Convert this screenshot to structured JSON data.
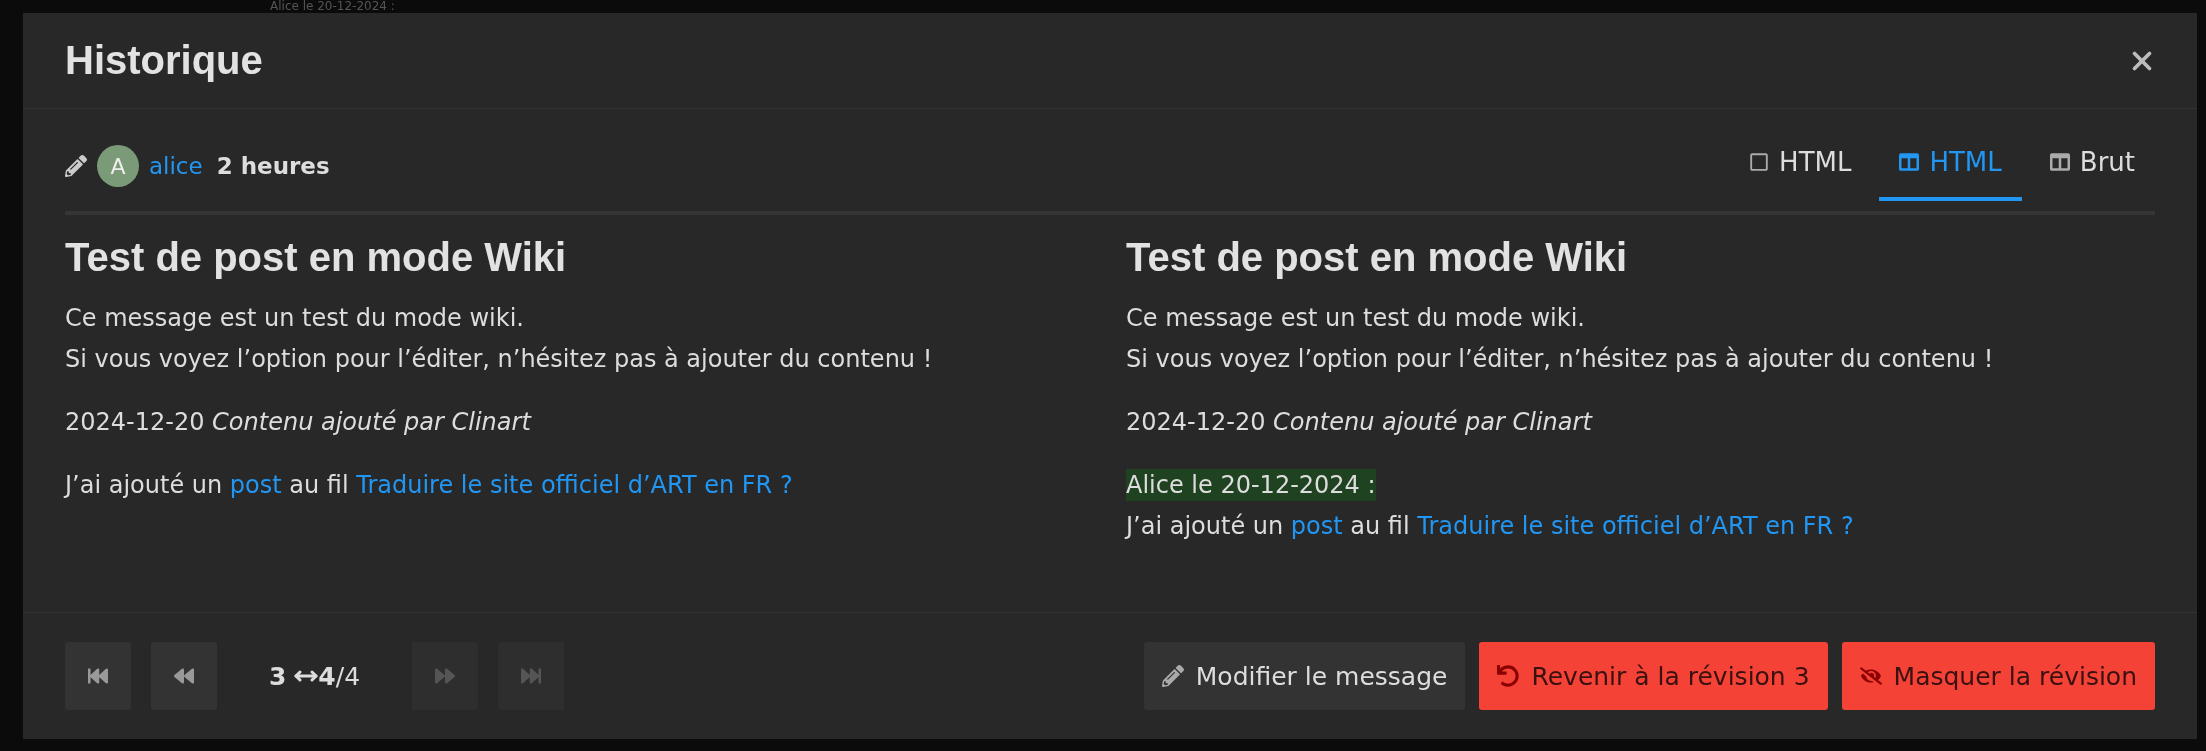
{
  "backdrop_text": "Alice le 20-12-2024 :",
  "modal": {
    "title": "Historique",
    "revision": {
      "author_initial": "A",
      "author": "alice",
      "age": "2 heures"
    },
    "view_tabs": [
      {
        "label": "HTML",
        "kind": "inline",
        "selected": false
      },
      {
        "label": "HTML",
        "kind": "side_by_side",
        "selected": true
      },
      {
        "label": "Brut",
        "kind": "side_by_side",
        "selected": false
      }
    ],
    "columns": [
      {
        "heading": "Test de post en mode Wiki",
        "paragraphs": [
          [
            [
              {
                "kind": "text",
                "text": "Ce message est un test du mode wiki."
              }
            ],
            [
              {
                "kind": "text",
                "text": "Si vous voyez l’option pour l’éditer, n’hésitez pas à ajouter du contenu !"
              }
            ]
          ],
          [
            [
              {
                "kind": "text",
                "text": "2024-12-20 *Contenu ajouté par Clinart*"
              }
            ]
          ],
          [
            [
              {
                "kind": "text",
                "text": "J’ai ajouté un "
              },
              {
                "kind": "link",
                "text": "post"
              },
              {
                "kind": "text",
                "text": " au fil "
              },
              {
                "kind": "link",
                "text": "Traduire le site officiel d’ART en FR ?"
              }
            ]
          ]
        ]
      },
      {
        "heading": "Test de post en mode Wiki",
        "paragraphs": [
          [
            [
              {
                "kind": "text",
                "text": "Ce message est un test du mode wiki."
              }
            ],
            [
              {
                "kind": "text",
                "text": "Si vous voyez l’option pour l’éditer, n’hésitez pas à ajouter du contenu !"
              }
            ]
          ],
          [
            [
              {
                "kind": "text",
                "text": "2024-12-20 *Contenu ajouté par Clinart*"
              }
            ]
          ],
          [
            [
              {
                "kind": "inserted",
                "text": "Alice le 20-12-2024 :"
              }
            ],
            [
              {
                "kind": "text",
                "text": "J’ai ajouté un "
              },
              {
                "kind": "link",
                "text": "post"
              },
              {
                "kind": "text",
                "text": " au fil "
              },
              {
                "kind": "link",
                "text": "Traduire le site officiel d’ART en FR ?"
              }
            ]
          ]
        ]
      }
    ],
    "pager": {
      "buttons": [
        {
          "kind": "first",
          "disabled": false
        },
        {
          "kind": "previous",
          "disabled": false
        },
        {
          "kind": "next",
          "disabled": true
        },
        {
          "kind": "last",
          "disabled": true
        }
      ],
      "from": "3",
      "to": "4",
      "total": "/4"
    },
    "actions": [
      {
        "kind": "edit",
        "label": "Modifier le message"
      },
      {
        "kind": "revert",
        "label": "Revenir à la révision 3"
      },
      {
        "kind": "hide",
        "label": "Masquer la révision"
      }
    ]
  }
}
